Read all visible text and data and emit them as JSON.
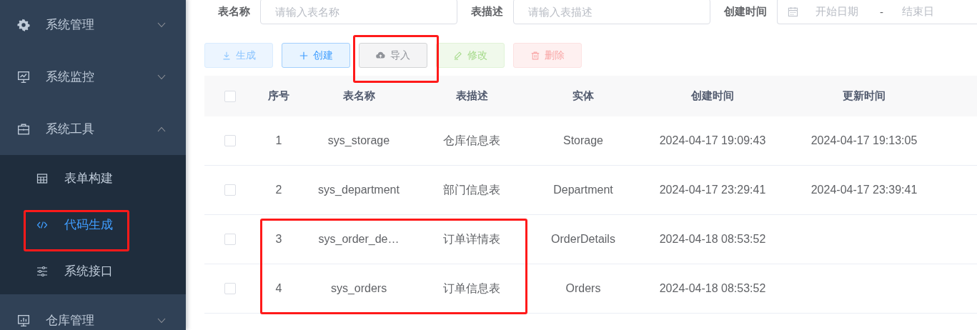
{
  "sidebar": {
    "items": [
      {
        "label": "系统管理",
        "expanded": false
      },
      {
        "label": "系统监控",
        "expanded": false
      },
      {
        "label": "系统工具",
        "expanded": true,
        "children": [
          {
            "label": "表单构建",
            "selected": false
          },
          {
            "label": "代码生成",
            "selected": true
          },
          {
            "label": "系统接口",
            "selected": false
          }
        ]
      },
      {
        "label": "仓库管理",
        "expanded": false
      }
    ]
  },
  "search": {
    "fields": [
      {
        "label": "表名称",
        "kind": "text",
        "placeholder": "请输入表名称"
      },
      {
        "label": "表描述",
        "kind": "text",
        "placeholder": "请输入表描述"
      },
      {
        "label": "创建时间",
        "kind": "daterange",
        "start_placeholder": "开始日期",
        "separator": "-",
        "end_placeholder": "结束日"
      }
    ]
  },
  "toolbar": {
    "buttons": [
      {
        "label": "生成",
        "kind": "primary",
        "disabled": true
      },
      {
        "label": "创建",
        "kind": "primary",
        "disabled": false
      },
      {
        "label": "导入",
        "kind": "info",
        "disabled": false
      },
      {
        "label": "修改",
        "kind": "success",
        "disabled": true
      },
      {
        "label": "删除",
        "kind": "danger",
        "disabled": true
      }
    ]
  },
  "table": {
    "columns": [
      "序号",
      "表名称",
      "表描述",
      "实体",
      "创建时间",
      "更新时间"
    ],
    "all_checked": false,
    "rows": [
      {
        "checked": false,
        "cells": [
          "1",
          "sys_storage",
          "仓库信息表",
          "Storage",
          "2024-04-17 19:09:43",
          "2024-04-17 19:13:05"
        ]
      },
      {
        "checked": false,
        "cells": [
          "2",
          "sys_department",
          "部门信息表",
          "Department",
          "2024-04-17 23:29:41",
          "2024-04-17 23:39:41"
        ]
      },
      {
        "checked": false,
        "cells": [
          "3",
          "sys_order_de…",
          "订单详情表",
          "OrderDetails",
          "2024-04-18 08:53:52",
          ""
        ]
      },
      {
        "checked": false,
        "cells": [
          "4",
          "sys_orders",
          "订单信息表",
          "Orders",
          "2024-04-18 08:53:52",
          ""
        ]
      }
    ]
  }
}
